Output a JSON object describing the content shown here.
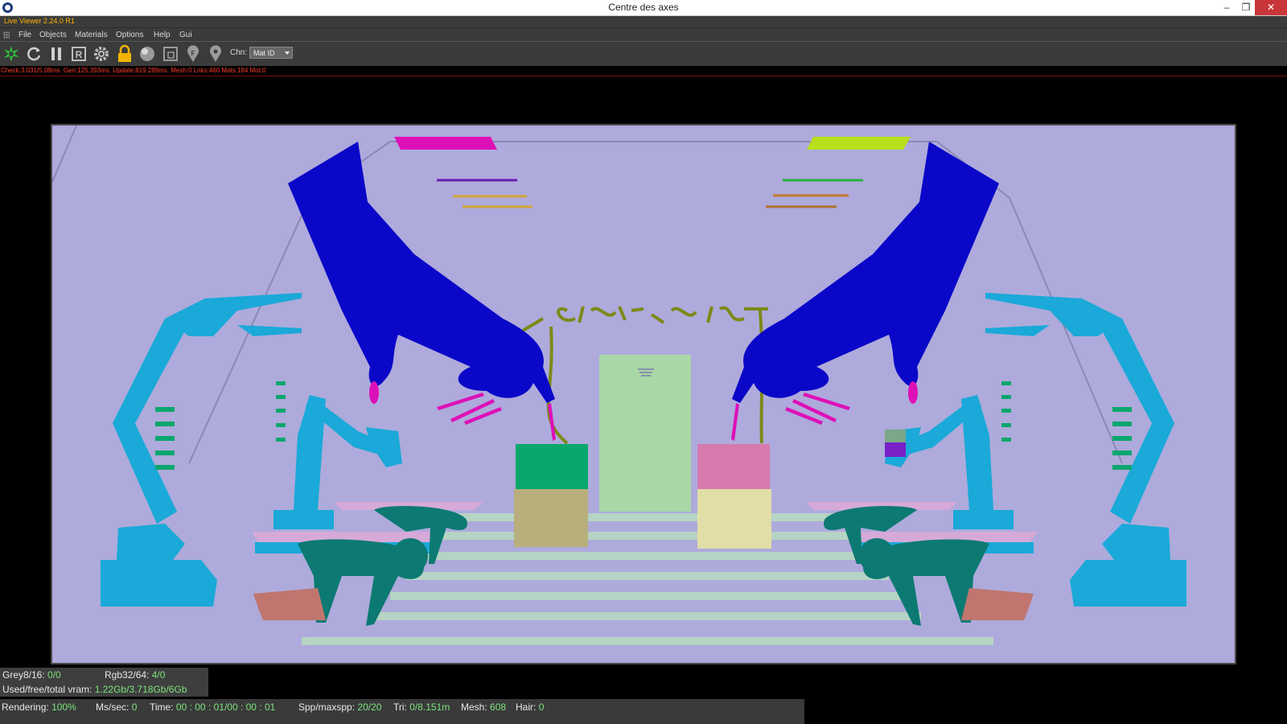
{
  "window": {
    "title": "Centre des axes",
    "app_name": "Live Viewer 2.24.0 R1",
    "minimize_glyph": "–",
    "restore_glyph": "❐",
    "close_glyph": "✕"
  },
  "menu": {
    "items": [
      "File",
      "Objects",
      "Materials",
      "Options",
      "Help",
      "Gui"
    ]
  },
  "toolbar": {
    "icons": [
      "spark-icon",
      "refresh-icon",
      "pause-icon",
      "r-icon",
      "gear-icon",
      "lock-icon",
      "sphere-icon",
      "frame-icon",
      "pin-f-icon",
      "pin-icon"
    ],
    "chn_label": "Chn:",
    "channel_value": "Mat ID",
    "accent_color": "#ffb300"
  },
  "status": {
    "text": "Check:3.031/5.08ms. Gen:125.393ms. Update:819.289ms. Mesh:0 Lnks:460 Mats:184 Mot:0"
  },
  "info": {
    "grey_label": "Grey8/16:",
    "grey_value": "0/0",
    "rgb_label": "Rgb32/64:",
    "rgb_value": "4/0",
    "vram_label": "Used/free/total vram:",
    "vram_value": "1.22Gb/3.718Gb/6Gb"
  },
  "render": {
    "rendering_label": "Rendering:",
    "rendering_value": "100%",
    "ms_label": "Ms/sec:",
    "ms_value": "0",
    "time_label": "Time:",
    "time_value": "00 : 00 : 01/00 : 00 : 01",
    "spp_label": "Spp/maxspp:",
    "spp_value": "20/20",
    "tri_label": "Tri:",
    "tri_value": "0/8.151m",
    "mesh_label": "Mesh:",
    "mesh_value": "608",
    "hair_label": "Hair:",
    "hair_value": "0"
  },
  "colors": {
    "background": "#aeaadc",
    "hand": "#0a07c8",
    "robot_arm": "#1aa9d8",
    "figure": "#0c7a72",
    "skin": "#c0766f",
    "table": "#d6a9d9",
    "door": "#a8d8a6",
    "cake_green": "#0aa76d",
    "cake_pink": "#d67aae",
    "base_khaki": "#b8af7c",
    "base_cream": "#e2dea8",
    "neon_magenta": "#dd10b8",
    "neon_lime": "#b8e01a",
    "text_olive": "#7c8a18"
  }
}
